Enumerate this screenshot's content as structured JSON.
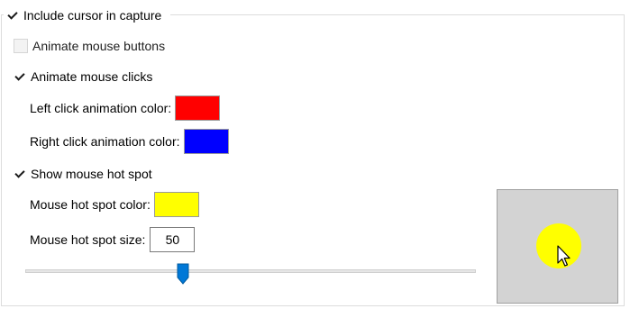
{
  "group": {
    "title": "Include cursor in capture",
    "include_cursor_checked": true
  },
  "options": {
    "animate_buttons": {
      "label": "Animate mouse buttons",
      "checked": false
    },
    "animate_clicks": {
      "label": "Animate mouse clicks",
      "checked": true
    },
    "show_hot_spot": {
      "label": "Show mouse hot spot",
      "checked": true
    }
  },
  "colors": {
    "left_click": {
      "label": "Left click animation color:",
      "value": "#ff0000"
    },
    "right_click": {
      "label": "Right click animation color:",
      "value": "#0000ff"
    },
    "hot_spot": {
      "label": "Mouse hot spot color:",
      "value": "#ffff00"
    }
  },
  "hot_spot_size": {
    "label": "Mouse hot spot size:",
    "value": "50",
    "slider_fraction": 0.35
  },
  "preview": {
    "background": "#d3d3d3",
    "icon": "cursor-arrow-icon"
  }
}
